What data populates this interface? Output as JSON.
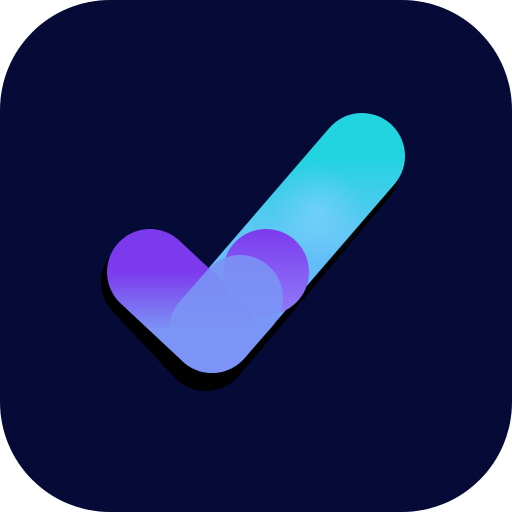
{
  "app_icon": {
    "icon": "checkmark-icon",
    "colors": {
      "background": "#050a36",
      "shadow": "#000000",
      "short_stroke_top": "#7c3aed",
      "short_stroke_bottom": "#7b94f5",
      "long_stroke_top": "#22d3e0",
      "long_stroke_mid": "#60c7f5",
      "long_stroke_bottom": "#6aa9ff",
      "highlight": "#8ad4ff"
    }
  }
}
